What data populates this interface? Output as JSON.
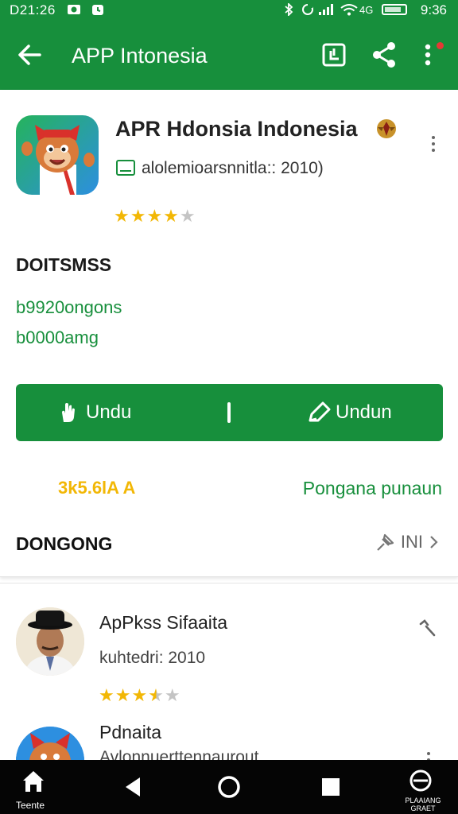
{
  "status_bar": {
    "time_left": "D21:26",
    "time_right": "9:36",
    "icons": [
      "photo-icon",
      "alarm-icon",
      "bluetooth-icon",
      "signal-icon",
      "wifi-icon",
      "battery-icon"
    ]
  },
  "app_bar": {
    "title": "APP Intonesia",
    "actions": [
      "open-external-icon",
      "share-icon",
      "more-vert-icon"
    ],
    "accent": "#178f3c"
  },
  "app": {
    "title": "APR Hdonsia Indonesia",
    "developer": "alolemioarsnnitla:: 2010)",
    "rating_stars": 4,
    "rating_max": 5
  },
  "details": {
    "heading": "DOITSMSS",
    "line1": "b9920ongons",
    "line2": "b0000amg"
  },
  "install_button": {
    "left_label": "Undu",
    "right_label": "Undun"
  },
  "meta_row": {
    "rating_text": "3k5.6lA A",
    "link_text": "Pongana punaun"
  },
  "section_row": {
    "label": "DONGONG",
    "right_text": "INI"
  },
  "list": [
    {
      "title": "ApPkss Sifaaita",
      "subtitle": "kuhtedri: 2010",
      "stars": 3.5
    },
    {
      "title": "Pdnaita",
      "subtitle": "Avlonnuerttennaurout"
    }
  ],
  "nav": {
    "home_label": "Teente",
    "right_label": "PLAAIANG GRAET"
  }
}
